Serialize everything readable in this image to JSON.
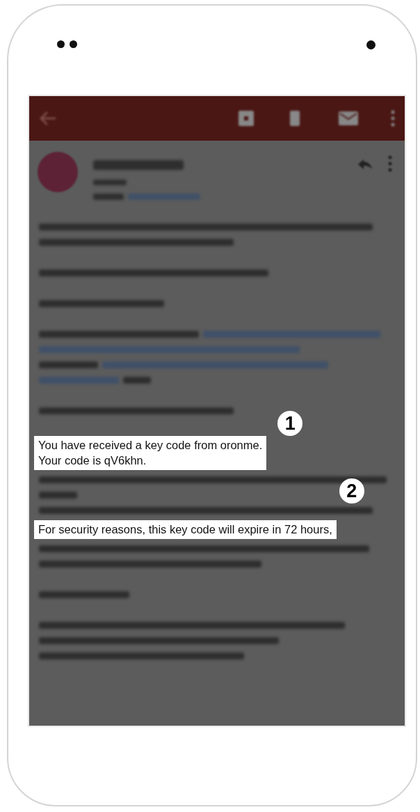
{
  "highlights": [
    {
      "callout": "1",
      "lines": [
        "You have received a key code from oronme.",
        "Your code is qV6khn."
      ]
    },
    {
      "callout": "2",
      "lines": [
        "For security reasons, this key code will expire in 72 hours,"
      ]
    }
  ]
}
